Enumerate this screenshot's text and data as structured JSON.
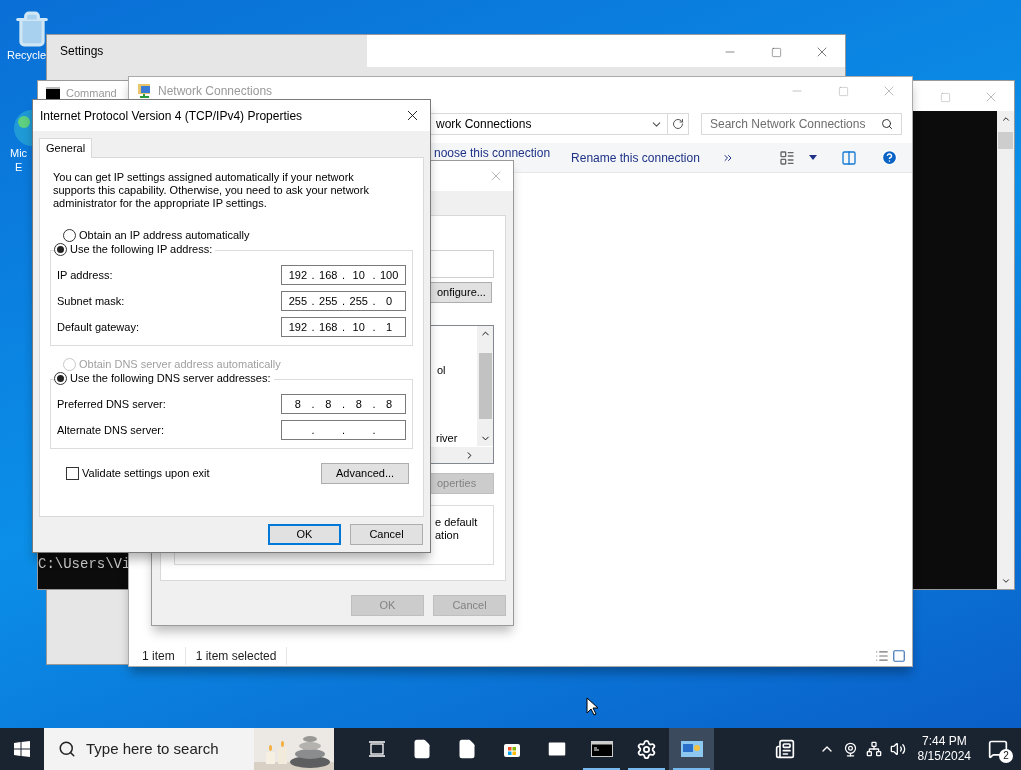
{
  "desktop_icons": [
    {
      "kind": "recycle_bin",
      "lines": [
        "Recycle"
      ]
    },
    {
      "kind": "browser",
      "lines": [
        "Mic",
        "E"
      ]
    }
  ],
  "settings_window": {
    "title": "Settings"
  },
  "command_window": {
    "title": "Command",
    "console_line": "C:\\Users\\Vi"
  },
  "network_window": {
    "title": "Network Connections",
    "address": "work Connections",
    "search": {
      "placeholder": "Search Network Connections"
    },
    "toolbar": [
      "noose this connection",
      "Rename this connection"
    ],
    "status_bar": [
      "1 item",
      "1 item selected"
    ]
  },
  "ethernet_dialog": {
    "configure_button": {
      "label": "onfigure...",
      "disabled": false
    },
    "list_items": [
      "ol",
      "river"
    ],
    "properties_button": {
      "label": "operties",
      "disabled": true
    },
    "description": "e default\nation",
    "buttons": [
      {
        "label": "OK",
        "disabled": true
      },
      {
        "label": "Cancel",
        "disabled": true
      }
    ]
  },
  "ipv4_dialog": {
    "title": "Internet Protocol Version 4 (TCP/IPv4) Properties",
    "tabs": [
      {
        "label": "General",
        "selected": true
      }
    ],
    "intro": "You can get IP settings assigned automatically if your network supports this capability. Otherwise, you need to ask your network administrator for the appropriate IP settings.",
    "separator": ".",
    "ip_options": [
      {
        "label": "Obtain an IP address automatically",
        "selected": false,
        "disabled": false
      },
      {
        "label": "Use the following IP address:",
        "selected": true,
        "disabled": false
      }
    ],
    "ip_fields": [
      {
        "label": "IP address:",
        "octets": [
          "192",
          "168",
          "10",
          "100"
        ]
      },
      {
        "label": "Subnet mask:",
        "octets": [
          "255",
          "255",
          "255",
          "0"
        ]
      },
      {
        "label": "Default gateway:",
        "octets": [
          "192",
          "168",
          "10",
          "1"
        ]
      }
    ],
    "dns_options": [
      {
        "label": "Obtain DNS server address automatically",
        "selected": false,
        "disabled": true
      },
      {
        "label": "Use the following DNS server addresses:",
        "selected": true,
        "disabled": false
      }
    ],
    "dns_fields": [
      {
        "label": "Preferred DNS server:",
        "octets": [
          "8",
          "8",
          "8",
          "8"
        ]
      },
      {
        "label": "Alternate DNS server:"
      }
    ],
    "validate": {
      "label": "Validate settings upon exit",
      "checked": false
    },
    "advanced_button": "Advanced...",
    "buttons": [
      {
        "label": "OK",
        "default": true
      },
      {
        "label": "Cancel",
        "default": false
      }
    ]
  },
  "taskbar": {
    "search": {
      "placeholder": "Type here to search"
    },
    "apps": [
      {
        "kind": "task_view",
        "running": false,
        "active": false
      },
      {
        "kind": "file",
        "running": false,
        "active": false
      },
      {
        "kind": "file",
        "running": false,
        "active": false
      },
      {
        "kind": "store",
        "running": false,
        "active": false
      },
      {
        "kind": "mail",
        "running": false,
        "active": false
      },
      {
        "kind": "terminal",
        "running": true,
        "active": false
      },
      {
        "kind": "settings",
        "running": true,
        "active": false
      },
      {
        "kind": "network",
        "running": true,
        "active": true
      }
    ],
    "clock": {
      "time": "7:44 PM",
      "date": "8/15/2024"
    },
    "notifications": {
      "count": "2"
    }
  }
}
